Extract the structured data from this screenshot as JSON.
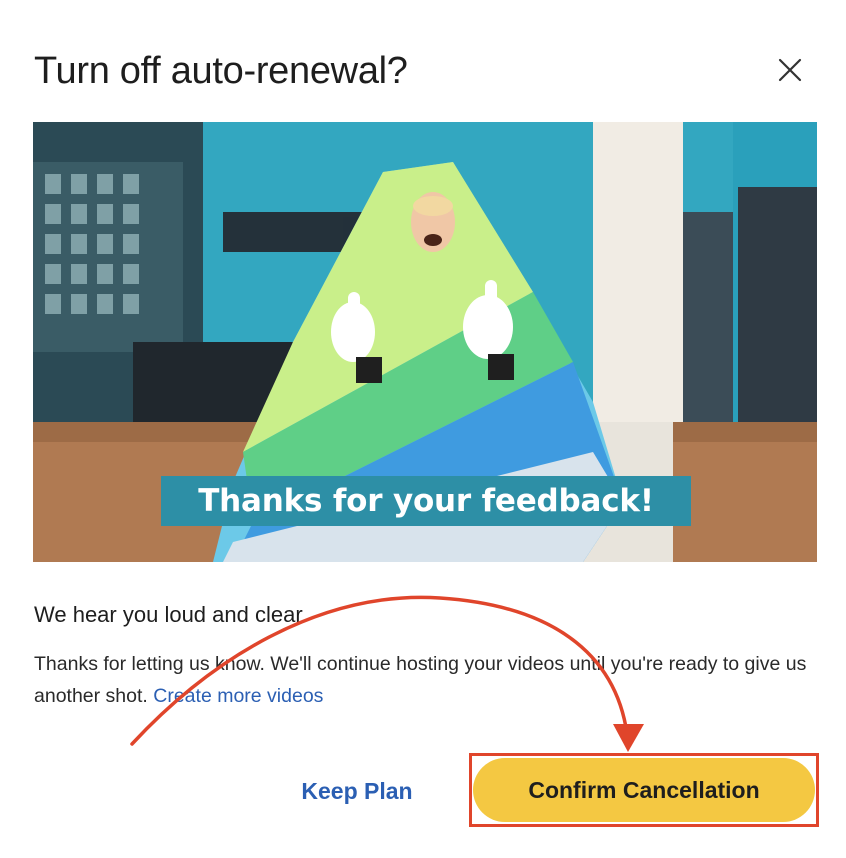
{
  "dialog": {
    "title": "Turn off auto-renewal?",
    "close_icon": "close-icon"
  },
  "hero": {
    "caption": "Thanks for your feedback!",
    "colors": {
      "wall": "#2fa3bd",
      "caption_bg": "#2d8fa6",
      "costume_green": "#6fd07a",
      "costume_blue": "#3f9be0"
    }
  },
  "message": {
    "heading": "We hear you loud and clear",
    "body": "Thanks for letting us know. We'll continue hosting your videos until you're ready to give us another shot.",
    "link": "Create more videos"
  },
  "actions": {
    "keep_label": "Keep Plan",
    "confirm_label": "Confirm Cancellation"
  },
  "colors": {
    "accent_yellow": "#f4c842",
    "link_blue": "#2b5fb3",
    "annotation_red": "#e0452b"
  }
}
